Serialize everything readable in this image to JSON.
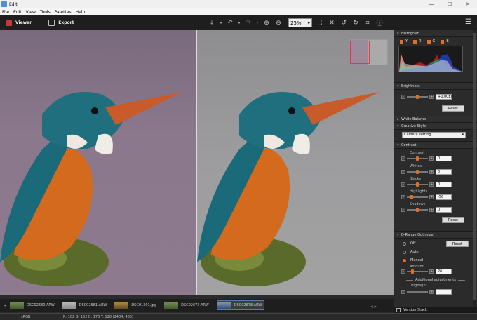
{
  "window": {
    "title": "Edit",
    "minimize": "—",
    "maximize": "☐",
    "close": "✕"
  },
  "menu": [
    "File",
    "Edit",
    "View",
    "Tools",
    "Palettes",
    "Help"
  ],
  "toolbar": {
    "viewer": "Viewer",
    "export": "Export",
    "zoom": "25%"
  },
  "filmstrip": {
    "items": [
      {
        "name": "DSC02680.ARW",
        "selected": false
      },
      {
        "name": "DSC02681.ARW",
        "selected": false
      },
      {
        "name": "DSC01301.jpg",
        "selected": false
      },
      {
        "name": "DSC02673.ARW",
        "selected": false
      },
      {
        "name": "DSC02678.ARW",
        "selected": true
      }
    ]
  },
  "status": {
    "colorspace": "sRGB",
    "pixel": "R: 102  G: 152  B: 178  Y: 128   (2434, 485)"
  },
  "version_stack": "Version Stack",
  "panel": {
    "histogram": {
      "title": "Histogram",
      "channels": [
        "Y",
        "R",
        "G",
        "B"
      ]
    },
    "brightness": {
      "title": "Brightness",
      "value": "+0.00EV",
      "reset": "Reset",
      "level": 0.5
    },
    "white_balance": {
      "title": "White Balance"
    },
    "creative_style": {
      "title": "Creative Style",
      "value": "Camera setting"
    },
    "contrast": {
      "title": "Contrast",
      "rows": [
        {
          "label": "Contrast",
          "value": "0",
          "level": 0.5
        },
        {
          "label": "Whites",
          "value": "0",
          "level": 0.5
        },
        {
          "label": "Blacks",
          "value": "0",
          "level": 0.5
        },
        {
          "label": "Highlights",
          "value": "-56",
          "level": 0.22
        },
        {
          "label": "Shadows",
          "value": "0",
          "level": 0.5
        }
      ],
      "reset": "Reset"
    },
    "drange": {
      "title": "D-Range Optimizer",
      "options": [
        {
          "label": "Off",
          "on": false
        },
        {
          "label": "Auto",
          "on": false
        },
        {
          "label": "Manual",
          "on": true
        }
      ],
      "reset": "Reset",
      "amount_label": "Amount",
      "amount_value": "26",
      "amount_level": 0.26,
      "additional": "Additional adjustments",
      "highlight_label": "Highlight"
    }
  },
  "colors": {
    "accent": "#e07020",
    "nav_frame": "#e34040"
  }
}
